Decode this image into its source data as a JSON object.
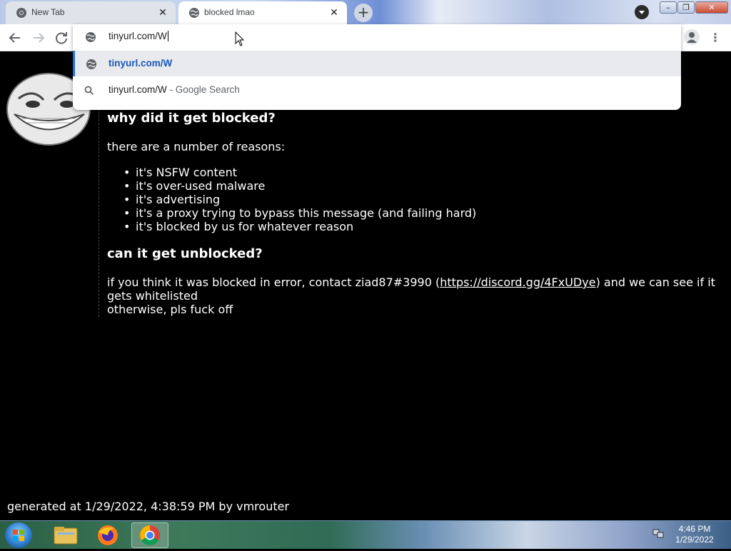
{
  "browser": {
    "tabs": [
      {
        "title": "New Tab",
        "active": false
      },
      {
        "title": "blocked lmao",
        "active": true
      }
    ],
    "omnibox": {
      "input": "tinyurl.com/W",
      "suggestions": [
        {
          "text": "tinyurl.com/W",
          "icon": "globe-icon",
          "selected": true
        },
        {
          "text": "tinyurl.com/W",
          "suffix": " - Google Search",
          "icon": "search-icon",
          "selected": false
        }
      ]
    }
  },
  "page": {
    "heading1": "why did it get blocked?",
    "intro": "there are a number of reasons:",
    "reasons": [
      "it's NSFW content",
      "it's over-used malware",
      "it's advertising",
      "it's a proxy trying to bypass this message (and failing hard)",
      "it's blocked by us for whatever reason"
    ],
    "heading2": "can it get unblocked?",
    "para_before_link": "if you think it was blocked in error, contact ziad87#3990 (",
    "link": "https://discord.gg/4FxUDye",
    "para_after_link": ") and we can see if it",
    "para_line2": "gets whitelisted",
    "para_line3": "otherwise, pls fuck off",
    "footer": "generated at 1/29/2022, 4:38:59 PM by vmrouter"
  },
  "taskbar": {
    "time": "4:46 PM",
    "date": "1/29/2022",
    "apps": [
      "windows-explorer",
      "firefox",
      "chrome"
    ]
  },
  "colors": {
    "accent": "#1a73e8",
    "page_bg": "#000000",
    "page_text": "#ffffff"
  }
}
